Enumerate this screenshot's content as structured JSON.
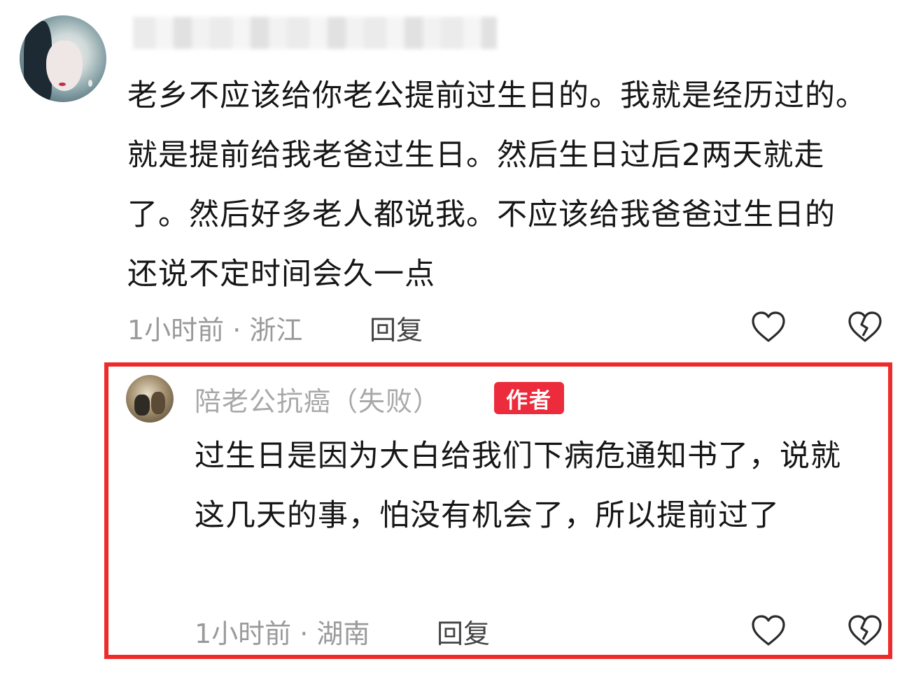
{
  "comments": [
    {
      "username": "",
      "text": "老乡不应该给你老公提前过生日的。我就是经历过的。就是提前给我老爸过生日。然后生日过后2两天就走了。然后好多老人都说我。不应该给我爸爸过生日的 还说不定时间会久一点",
      "meta": "1小时前 · 浙江",
      "reply_label": "回复",
      "like_icon": "heart-outline-icon",
      "dislike_icon": "broken-heart-icon"
    },
    {
      "username": "陪老公抗癌（失败）",
      "badge": "作者",
      "text": "过生日是因为大白给我们下病危通知书了，说就这几天的事，怕没有机会了，所以提前过了",
      "meta": "1小时前 · 湖南",
      "reply_label": "回复",
      "like_icon": "heart-outline-icon",
      "dislike_icon": "broken-heart-icon"
    }
  ],
  "colors": {
    "highlight_border": "#ee2b2b",
    "badge_bg": "#ec2c3c",
    "meta_text": "#9a9a9a",
    "body_text": "#161616"
  }
}
